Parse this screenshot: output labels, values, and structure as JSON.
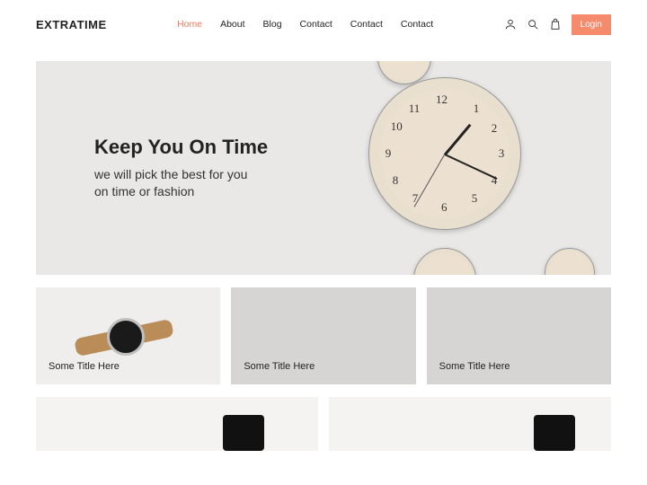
{
  "brand": "EXTRATIME",
  "nav": {
    "items": [
      {
        "label": "Home",
        "active": true
      },
      {
        "label": "About",
        "active": false
      },
      {
        "label": "Blog",
        "active": false
      },
      {
        "label": "Contact",
        "active": false
      },
      {
        "label": "Contact",
        "active": false
      },
      {
        "label": "Contact",
        "active": false
      }
    ]
  },
  "login_label": "Login",
  "hero": {
    "title": "Keep You On Time",
    "sub_line1": "we will pick the best for you",
    "sub_line2": "on time or fashion"
  },
  "cards": [
    {
      "title": "Some Title Here"
    },
    {
      "title": "Some Title Here"
    },
    {
      "title": "Some Title Here"
    }
  ],
  "colors": {
    "accent": "#f58a6c",
    "hero_bg": "#e9e8e6"
  }
}
